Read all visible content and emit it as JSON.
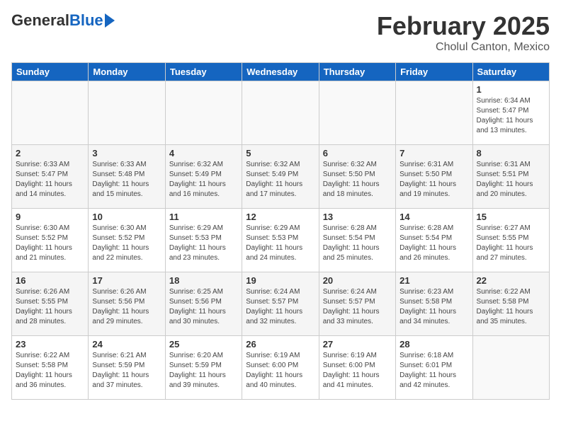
{
  "header": {
    "logo_general": "General",
    "logo_blue": "Blue",
    "title": "February 2025",
    "subtitle": "Cholul Canton, Mexico"
  },
  "weekdays": [
    "Sunday",
    "Monday",
    "Tuesday",
    "Wednesday",
    "Thursday",
    "Friday",
    "Saturday"
  ],
  "weeks": [
    [
      {
        "day": "",
        "info": ""
      },
      {
        "day": "",
        "info": ""
      },
      {
        "day": "",
        "info": ""
      },
      {
        "day": "",
        "info": ""
      },
      {
        "day": "",
        "info": ""
      },
      {
        "day": "",
        "info": ""
      },
      {
        "day": "1",
        "info": "Sunrise: 6:34 AM\nSunset: 5:47 PM\nDaylight: 11 hours and 13 minutes."
      }
    ],
    [
      {
        "day": "2",
        "info": "Sunrise: 6:33 AM\nSunset: 5:47 PM\nDaylight: 11 hours and 14 minutes."
      },
      {
        "day": "3",
        "info": "Sunrise: 6:33 AM\nSunset: 5:48 PM\nDaylight: 11 hours and 15 minutes."
      },
      {
        "day": "4",
        "info": "Sunrise: 6:32 AM\nSunset: 5:49 PM\nDaylight: 11 hours and 16 minutes."
      },
      {
        "day": "5",
        "info": "Sunrise: 6:32 AM\nSunset: 5:49 PM\nDaylight: 11 hours and 17 minutes."
      },
      {
        "day": "6",
        "info": "Sunrise: 6:32 AM\nSunset: 5:50 PM\nDaylight: 11 hours and 18 minutes."
      },
      {
        "day": "7",
        "info": "Sunrise: 6:31 AM\nSunset: 5:50 PM\nDaylight: 11 hours and 19 minutes."
      },
      {
        "day": "8",
        "info": "Sunrise: 6:31 AM\nSunset: 5:51 PM\nDaylight: 11 hours and 20 minutes."
      }
    ],
    [
      {
        "day": "9",
        "info": "Sunrise: 6:30 AM\nSunset: 5:52 PM\nDaylight: 11 hours and 21 minutes."
      },
      {
        "day": "10",
        "info": "Sunrise: 6:30 AM\nSunset: 5:52 PM\nDaylight: 11 hours and 22 minutes."
      },
      {
        "day": "11",
        "info": "Sunrise: 6:29 AM\nSunset: 5:53 PM\nDaylight: 11 hours and 23 minutes."
      },
      {
        "day": "12",
        "info": "Sunrise: 6:29 AM\nSunset: 5:53 PM\nDaylight: 11 hours and 24 minutes."
      },
      {
        "day": "13",
        "info": "Sunrise: 6:28 AM\nSunset: 5:54 PM\nDaylight: 11 hours and 25 minutes."
      },
      {
        "day": "14",
        "info": "Sunrise: 6:28 AM\nSunset: 5:54 PM\nDaylight: 11 hours and 26 minutes."
      },
      {
        "day": "15",
        "info": "Sunrise: 6:27 AM\nSunset: 5:55 PM\nDaylight: 11 hours and 27 minutes."
      }
    ],
    [
      {
        "day": "16",
        "info": "Sunrise: 6:26 AM\nSunset: 5:55 PM\nDaylight: 11 hours and 28 minutes."
      },
      {
        "day": "17",
        "info": "Sunrise: 6:26 AM\nSunset: 5:56 PM\nDaylight: 11 hours and 29 minutes."
      },
      {
        "day": "18",
        "info": "Sunrise: 6:25 AM\nSunset: 5:56 PM\nDaylight: 11 hours and 30 minutes."
      },
      {
        "day": "19",
        "info": "Sunrise: 6:24 AM\nSunset: 5:57 PM\nDaylight: 11 hours and 32 minutes."
      },
      {
        "day": "20",
        "info": "Sunrise: 6:24 AM\nSunset: 5:57 PM\nDaylight: 11 hours and 33 minutes."
      },
      {
        "day": "21",
        "info": "Sunrise: 6:23 AM\nSunset: 5:58 PM\nDaylight: 11 hours and 34 minutes."
      },
      {
        "day": "22",
        "info": "Sunrise: 6:22 AM\nSunset: 5:58 PM\nDaylight: 11 hours and 35 minutes."
      }
    ],
    [
      {
        "day": "23",
        "info": "Sunrise: 6:22 AM\nSunset: 5:58 PM\nDaylight: 11 hours and 36 minutes."
      },
      {
        "day": "24",
        "info": "Sunrise: 6:21 AM\nSunset: 5:59 PM\nDaylight: 11 hours and 37 minutes."
      },
      {
        "day": "25",
        "info": "Sunrise: 6:20 AM\nSunset: 5:59 PM\nDaylight: 11 hours and 39 minutes."
      },
      {
        "day": "26",
        "info": "Sunrise: 6:19 AM\nSunset: 6:00 PM\nDaylight: 11 hours and 40 minutes."
      },
      {
        "day": "27",
        "info": "Sunrise: 6:19 AM\nSunset: 6:00 PM\nDaylight: 11 hours and 41 minutes."
      },
      {
        "day": "28",
        "info": "Sunrise: 6:18 AM\nSunset: 6:01 PM\nDaylight: 11 hours and 42 minutes."
      },
      {
        "day": "",
        "info": ""
      }
    ]
  ]
}
